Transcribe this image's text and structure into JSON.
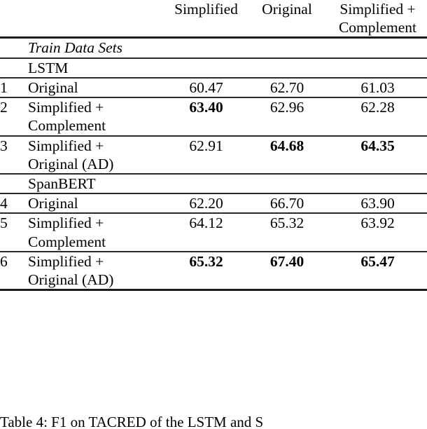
{
  "table": {
    "columns": [
      {
        "id": "index",
        "label": ""
      },
      {
        "id": "dataset",
        "label": ""
      },
      {
        "id": "simplified",
        "label_line1": "Simplified",
        "label_line2": ""
      },
      {
        "id": "original",
        "label_line1": "Original",
        "label_line2": ""
      },
      {
        "id": "simplified_complement",
        "label_line1": "Simplified +",
        "label_line2": "Complement"
      }
    ],
    "section_train": "Train Data Sets",
    "sections": [
      {
        "name": "LSTM",
        "rows": [
          {
            "index": "1",
            "label_line1": "Original",
            "label_line2": "",
            "values": [
              "60.47",
              "62.70",
              "61.03"
            ],
            "bold": [
              false,
              false,
              false
            ]
          },
          {
            "index": "2",
            "label_line1": "Simplified +",
            "label_line2": "Complement",
            "values": [
              "63.40",
              "62.96",
              "62.28"
            ],
            "bold": [
              true,
              false,
              false
            ]
          },
          {
            "index": "3",
            "label_line1": "Simplified +",
            "label_line2": "Original (AD)",
            "values": [
              "62.91",
              "64.68",
              "64.35"
            ],
            "bold": [
              false,
              true,
              true
            ]
          }
        ]
      },
      {
        "name": "SpanBERT",
        "rows": [
          {
            "index": "4",
            "label_line1": "Original",
            "label_line2": "",
            "values": [
              "62.20",
              "66.70",
              "63.90"
            ],
            "bold": [
              false,
              false,
              false
            ]
          },
          {
            "index": "5",
            "label_line1": "Simplified +",
            "label_line2": "Complement",
            "values": [
              "64.12",
              "65.32",
              "63.92"
            ],
            "bold": [
              false,
              false,
              false
            ]
          },
          {
            "index": "6",
            "label_line1": "Simplified +",
            "label_line2": "Original (AD)",
            "values": [
              "65.32",
              "67.40",
              "65.47"
            ],
            "bold": [
              true,
              true,
              true
            ]
          }
        ]
      }
    ]
  },
  "caption": {
    "text": "Table 4: F1 on TACRED of the LSTM and S"
  },
  "colors": {
    "rule": "#1b1b1b",
    "text": "#000000",
    "background": "#ffffff"
  }
}
